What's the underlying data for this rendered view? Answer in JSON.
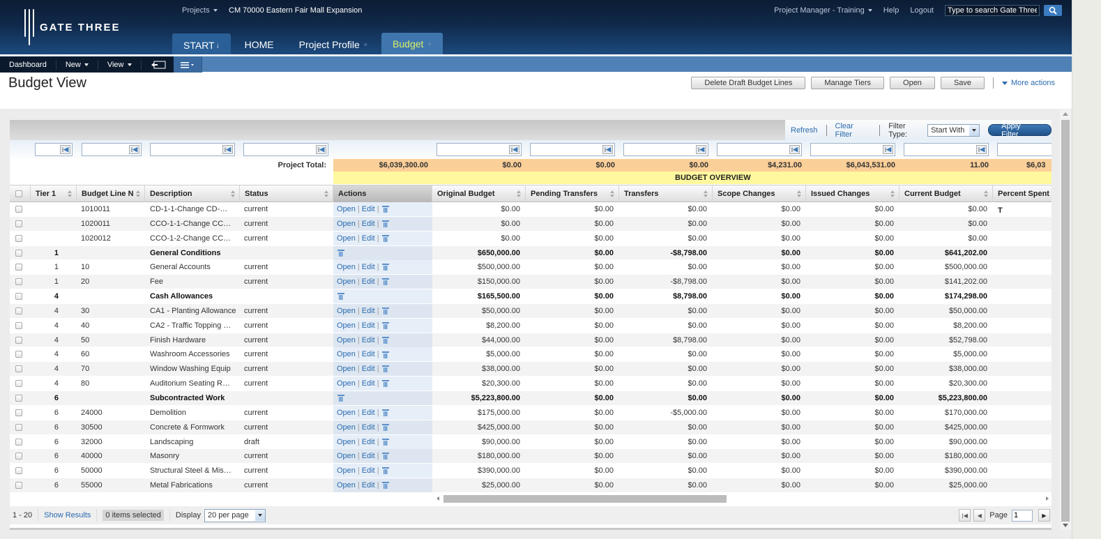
{
  "header": {
    "brand": "GATE THREE",
    "projects_label": "Projects",
    "project_name": "CM 70000 Eastern Fair Mall Expansion",
    "user_menu": "Project Manager - Training",
    "help": "Help",
    "logout": "Logout",
    "search_placeholder": "Type to search Gate Three"
  },
  "tabs": [
    {
      "label": "START",
      "closable": false
    },
    {
      "label": "HOME",
      "closable": false
    },
    {
      "label": "Project Profile",
      "closable": true
    },
    {
      "label": "Budget",
      "closable": true,
      "active": true
    }
  ],
  "toolbar": {
    "dashboard": "Dashboard",
    "new": "New",
    "view": "View"
  },
  "page": {
    "title": "Budget View",
    "actions": {
      "delete_draft": "Delete Draft Budget Lines",
      "manage_tiers": "Manage Tiers",
      "open": "Open",
      "save": "Save",
      "more_actions": "More actions"
    }
  },
  "filterbar": {
    "refresh": "Refresh",
    "clear_filter": "Clear Filter",
    "filter_type_label": "Filter Type:",
    "filter_type_value": "Start With",
    "apply_filter": "Apply Filter"
  },
  "totals": {
    "label": "Project Total:",
    "values": [
      "$6,039,300.00",
      "$0.00",
      "$0.00",
      "$0.00",
      "$4,231.00",
      "$6,043,531.00",
      "11.00",
      "$6,03"
    ]
  },
  "overview_label": "BUDGET OVERVIEW",
  "columns": [
    "Tier 1",
    "Budget Line N",
    "Description",
    "Status",
    "Actions",
    "Original Budget",
    "Pending Transfers",
    "Transfers",
    "Scope Changes",
    "Issued Changes",
    "Current Budget",
    "Percent Spent T"
  ],
  "row_actions": {
    "open": "Open",
    "edit": "Edit",
    "sep": "|"
  },
  "rows": [
    {
      "tier": "",
      "line": "1010011",
      "desc": "CD-1-1-Change CD-…",
      "status": "current",
      "group": false,
      "orig": "$0.00",
      "pend": "$0.00",
      "trans": "$0.00",
      "scope": "$0.00",
      "issued": "$0.00",
      "current": "$0.00"
    },
    {
      "tier": "",
      "line": "1020011",
      "desc": "CCO-1-1-Change CC…",
      "status": "current",
      "group": false,
      "orig": "$0.00",
      "pend": "$0.00",
      "trans": "$0.00",
      "scope": "$0.00",
      "issued": "$0.00",
      "current": "$0.00"
    },
    {
      "tier": "",
      "line": "1020012",
      "desc": "CCO-1-2-Change CC…",
      "status": "current",
      "group": false,
      "orig": "$0.00",
      "pend": "$0.00",
      "trans": "$0.00",
      "scope": "$0.00",
      "issued": "$0.00",
      "current": "$0.00"
    },
    {
      "tier": "1",
      "line": "",
      "desc": "General Conditions",
      "status": "",
      "group": true,
      "orig": "$650,000.00",
      "pend": "$0.00",
      "trans": "-$8,798.00",
      "scope": "$0.00",
      "issued": "$0.00",
      "current": "$641,202.00"
    },
    {
      "tier": "1",
      "line": "10",
      "desc": "General Accounts",
      "status": "current",
      "group": false,
      "orig": "$500,000.00",
      "pend": "$0.00",
      "trans": "$0.00",
      "scope": "$0.00",
      "issued": "$0.00",
      "current": "$500,000.00"
    },
    {
      "tier": "1",
      "line": "20",
      "desc": "Fee",
      "status": "current",
      "group": false,
      "orig": "$150,000.00",
      "pend": "$0.00",
      "trans": "-$8,798.00",
      "scope": "$0.00",
      "issued": "$0.00",
      "current": "$141,202.00"
    },
    {
      "tier": "4",
      "line": "",
      "desc": "Cash Allowances",
      "status": "",
      "group": true,
      "orig": "$165,500.00",
      "pend": "$0.00",
      "trans": "$8,798.00",
      "scope": "$0.00",
      "issued": "$0.00",
      "current": "$174,298.00"
    },
    {
      "tier": "4",
      "line": "30",
      "desc": "CA1 - Planting Allowance",
      "status": "current",
      "group": false,
      "orig": "$50,000.00",
      "pend": "$0.00",
      "trans": "$0.00",
      "scope": "$0.00",
      "issued": "$0.00",
      "current": "$50,000.00"
    },
    {
      "tier": "4",
      "line": "40",
      "desc": "CA2 - Traffic Topping …",
      "status": "current",
      "group": false,
      "orig": "$8,200.00",
      "pend": "$0.00",
      "trans": "$0.00",
      "scope": "$0.00",
      "issued": "$0.00",
      "current": "$8,200.00"
    },
    {
      "tier": "4",
      "line": "50",
      "desc": "Finish Hardware",
      "status": "current",
      "group": false,
      "orig": "$44,000.00",
      "pend": "$0.00",
      "trans": "$8,798.00",
      "scope": "$0.00",
      "issued": "$0.00",
      "current": "$52,798.00"
    },
    {
      "tier": "4",
      "line": "60",
      "desc": "Washroom Accessories",
      "status": "current",
      "group": false,
      "orig": "$5,000.00",
      "pend": "$0.00",
      "trans": "$0.00",
      "scope": "$0.00",
      "issued": "$0.00",
      "current": "$5,000.00"
    },
    {
      "tier": "4",
      "line": "70",
      "desc": "Window Washing Equip",
      "status": "current",
      "group": false,
      "orig": "$38,000.00",
      "pend": "$0.00",
      "trans": "$0.00",
      "scope": "$0.00",
      "issued": "$0.00",
      "current": "$38,000.00"
    },
    {
      "tier": "4",
      "line": "80",
      "desc": "Auditorium Seating R…",
      "status": "current",
      "group": false,
      "orig": "$20,300.00",
      "pend": "$0.00",
      "trans": "$0.00",
      "scope": "$0.00",
      "issued": "$0.00",
      "current": "$20,300.00"
    },
    {
      "tier": "6",
      "line": "",
      "desc": "Subcontracted Work",
      "status": "",
      "group": true,
      "orig": "$5,223,800.00",
      "pend": "$0.00",
      "trans": "$0.00",
      "scope": "$0.00",
      "issued": "$0.00",
      "current": "$5,223,800.00"
    },
    {
      "tier": "6",
      "line": "24000",
      "desc": "Demolition",
      "status": "current",
      "group": false,
      "orig": "$175,000.00",
      "pend": "$0.00",
      "trans": "-$5,000.00",
      "scope": "$0.00",
      "issued": "$0.00",
      "current": "$170,000.00"
    },
    {
      "tier": "6",
      "line": "30500",
      "desc": "Concrete & Formwork",
      "status": "current",
      "group": false,
      "orig": "$425,000.00",
      "pend": "$0.00",
      "trans": "$0.00",
      "scope": "$0.00",
      "issued": "$0.00",
      "current": "$425,000.00"
    },
    {
      "tier": "6",
      "line": "32000",
      "desc": "Landscaping",
      "status": "draft",
      "group": false,
      "orig": "$90,000.00",
      "pend": "$0.00",
      "trans": "$0.00",
      "scope": "$0.00",
      "issued": "$0.00",
      "current": "$90,000.00"
    },
    {
      "tier": "6",
      "line": "40000",
      "desc": "Masonry",
      "status": "current",
      "group": false,
      "orig": "$180,000.00",
      "pend": "$0.00",
      "trans": "$0.00",
      "scope": "$0.00",
      "issued": "$0.00",
      "current": "$180,000.00"
    },
    {
      "tier": "6",
      "line": "50000",
      "desc": "Structural Steel & Mis…",
      "status": "current",
      "group": false,
      "orig": "$390,000.00",
      "pend": "$0.00",
      "trans": "$0.00",
      "scope": "$0.00",
      "issued": "$0.00",
      "current": "$390,000.00"
    },
    {
      "tier": "6",
      "line": "55000",
      "desc": "Metal Fabrications",
      "status": "current",
      "group": false,
      "orig": "$25,000.00",
      "pend": "$0.00",
      "trans": "$0.00",
      "scope": "$0.00",
      "issued": "$0.00",
      "current": "$25,000.00"
    }
  ],
  "footer": {
    "range": "1 - 20",
    "show_results": "Show Results",
    "items_selected": "0 items selected",
    "display_label": "Display",
    "per_page": "20 per page",
    "page_label": "Page",
    "page_value": "1"
  },
  "colors": {
    "accent": "#2a6aae",
    "active_tab_text": "#d8ef6a",
    "totals_bg": "#fbcf98",
    "overview_bg": "#fff89e"
  }
}
